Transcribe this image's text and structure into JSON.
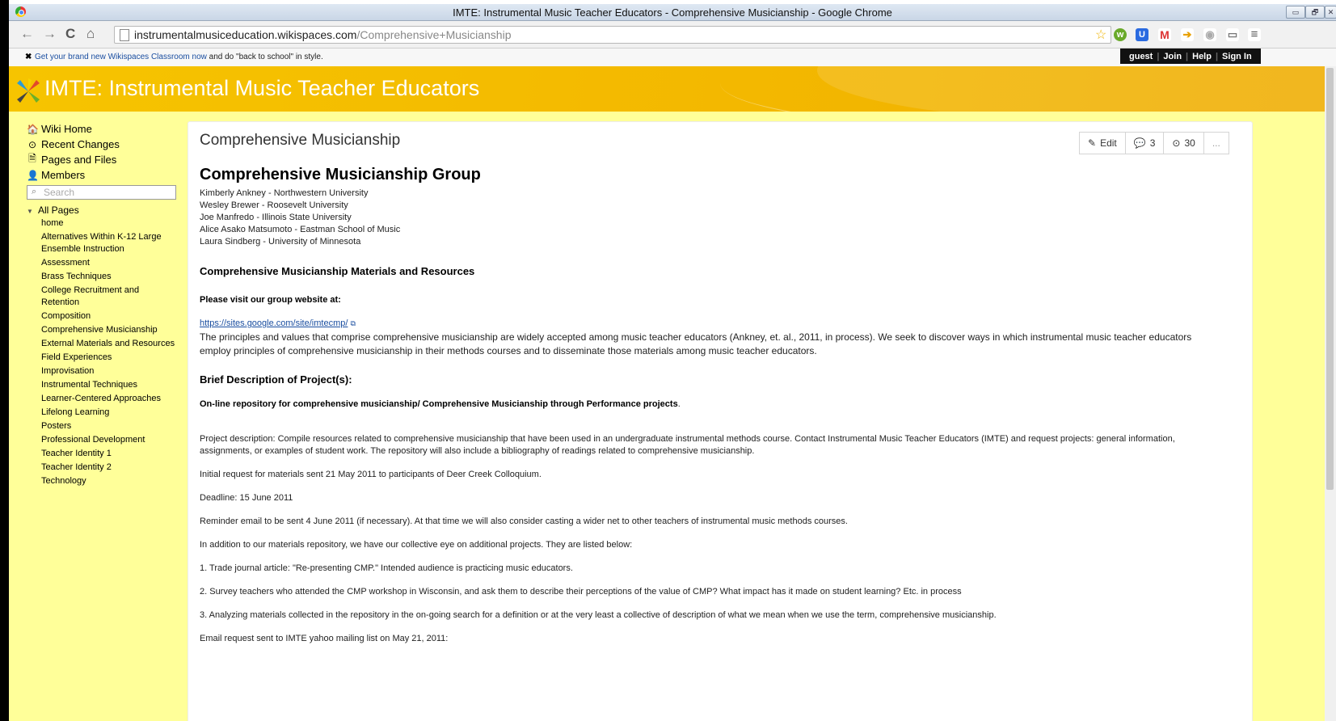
{
  "window": {
    "title": "IMTE: Instrumental Music Teacher Educators - Comprehensive Musicianship - Google Chrome",
    "controls": [
      "▭",
      "🗗",
      "✕"
    ]
  },
  "toolbar": {
    "back": "←",
    "forward": "→",
    "reload": "C",
    "home": "⌂",
    "url_host": "instrumentalmusiceducation.wikispaces.com",
    "url_path": "/Comprehensive+Musicianship",
    "star": "☆"
  },
  "notification": {
    "close": "✖",
    "link_text": "Get your brand new Wikispaces Classroom now",
    "rest_text": " and do \"back to school\" in style."
  },
  "userbar": {
    "items": [
      "guest",
      "Join",
      "Help",
      "Sign In"
    ]
  },
  "header": {
    "site_title": "IMTE: Instrumental Music Teacher Educators"
  },
  "sidebar": {
    "links": [
      {
        "label": "Wiki Home",
        "icon": "home-icon",
        "glyph": "🏠"
      },
      {
        "label": "Recent Changes",
        "icon": "clock-icon",
        "glyph": "⊙"
      },
      {
        "label": "Pages and Files",
        "icon": "file-icon",
        "glyph": "🗎"
      },
      {
        "label": "Members",
        "icon": "user-icon",
        "glyph": "👤"
      }
    ],
    "search_placeholder": "Search",
    "all_pages_label": "All Pages",
    "pages": [
      "home",
      "Alternatives Within K-12 Large Ensemble Instruction",
      "Assessment",
      "Brass Techniques",
      "College Recruitment and Retention",
      "Composition",
      "Comprehensive Musicianship",
      "External Materials and Resources",
      "Field Experiences",
      "Improvisation",
      "Instrumental Techniques",
      "Learner-Centered Approaches",
      "Lifelong Learning",
      "Posters",
      "Professional Development",
      "Teacher Identity 1",
      "Teacher Identity 2",
      "Technology"
    ]
  },
  "page": {
    "heading": "Comprehensive Musicianship",
    "actions": {
      "edit": "Edit",
      "comments": "3",
      "history": "30",
      "more": "..."
    },
    "group_title": "Comprehensive Musicianship Group",
    "members": [
      "Kimberly Ankney - Northwestern University",
      "Wesley Brewer - Roosevelt University",
      "Joe Manfredo - Illinois State University",
      "Alice Asako Matsumoto - Eastman School of Music",
      "Laura Sindberg - University of Minnesota"
    ],
    "materials_heading": "Comprehensive Musicianship Materials and Resources",
    "visit_label": "Please visit our group website at:",
    "website_url": "https://sites.google.com/site/imtecmp/",
    "principles_para": "The principles and values that comprise comprehensive musicianship are widely accepted among music teacher educators (Ankney, et. al., 2011, in process). We seek to discover ways in which instrumental music teacher educators employ principles of comprehensive musicianship in their methods courses and to disseminate those materials among music teacher educators.",
    "brief_heading": "Brief Description of Project(s):",
    "repo_line": "On-line repository for comprehensive musicianship/ Comprehensive Musicianship through Performance projects",
    "repo_period": ".",
    "project_desc": "Project description: Compile resources related to comprehensive musicianship that have been used in an undergraduate instrumental methods course. Contact Instrumental Music Teacher Educators (IMTE) and request projects: general information, assignments, or examples of student work. The repository will also include a bibliography of readings related to comprehensive musicianship.",
    "initial_request": "Initial request for materials sent 21 May 2011 to participants of Deer Creek Colloquium.",
    "deadline": "Deadline: 15 June 2011",
    "reminder": "Reminder email to be sent 4 June 2011 (if necessary). At that time we will also consider casting a wider net to other teachers of instrumental music methods courses.",
    "addition": "In addition to our materials repository, we have our collective eye on additional projects. They are listed below:",
    "item1": "1. Trade journal article: \"Re-presenting CMP.\" Intended audience is practicing music educators.",
    "item2": "2. Survey teachers who attended the CMP workshop in Wisconsin, and ask them to describe their perceptions of the value of CMP? What impact has it made on student learning? Etc. in process",
    "item3": "3. Analyzing materials collected in the repository in the on-going search for a definition or at the very least a collective of description of what we mean when we use the term, comprehensive musicianship.",
    "email_request": "Email request sent to IMTE yahoo mailing list on May 21, 2011:"
  },
  "colors": {
    "banner": "#f3b800",
    "page_bg": "#ffff99",
    "link": "#1a4ea0"
  }
}
